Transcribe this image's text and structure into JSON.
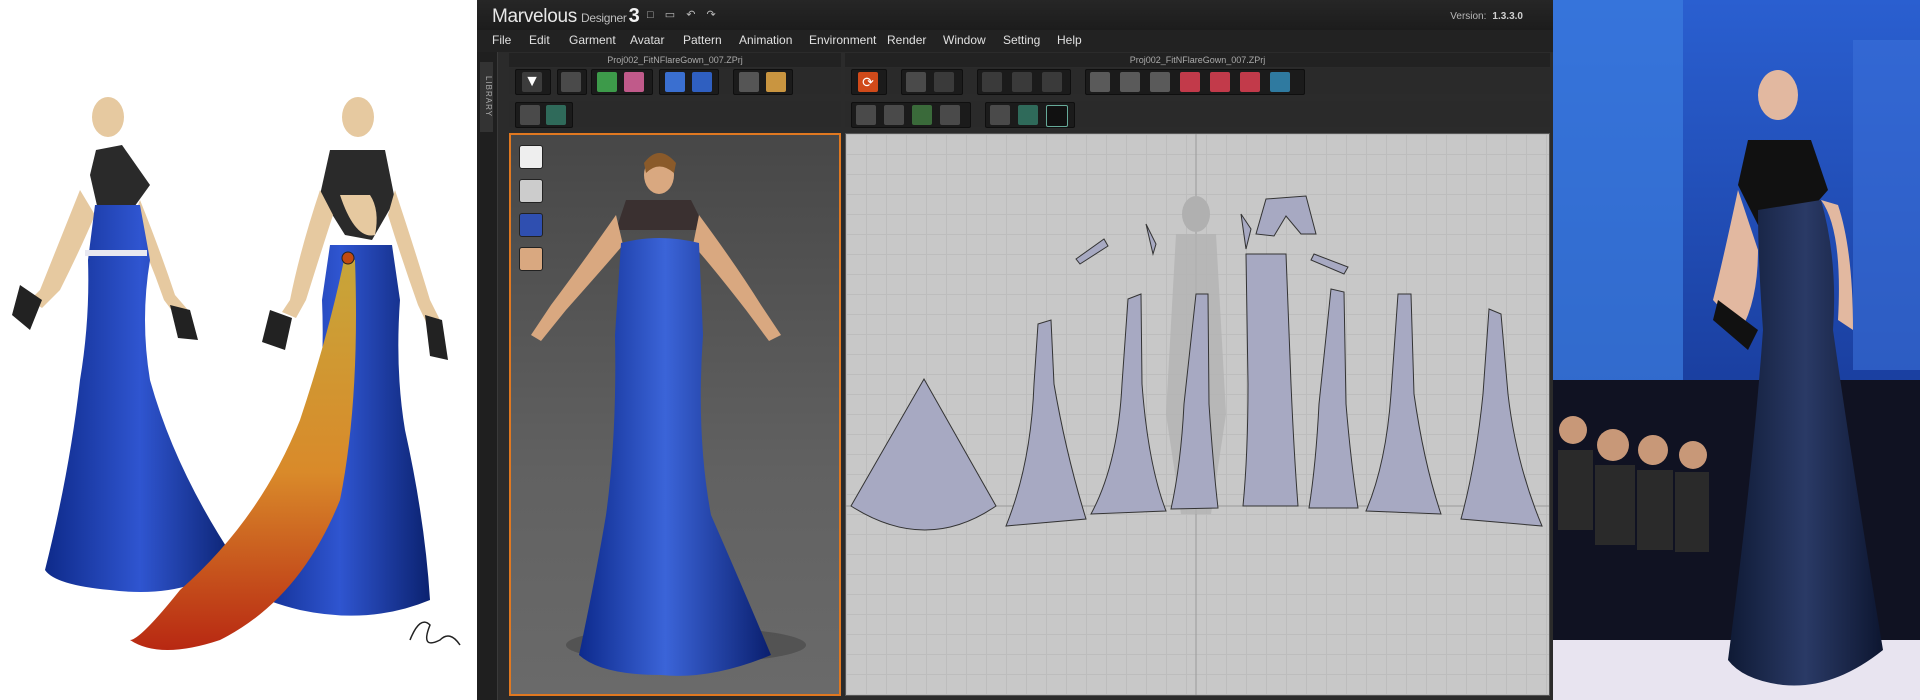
{
  "app": {
    "brand": "Marvelous",
    "brand_sub": "Designer",
    "brand_num": "3",
    "version_label": "Version:",
    "version_value": "1.3.3.0"
  },
  "menu": [
    "File",
    "Edit",
    "Garment",
    "Avatar",
    "Pattern",
    "Animation",
    "Environment",
    "Render",
    "Window",
    "Setting",
    "Help"
  ],
  "sidebar": {
    "library_label": "LIBRARY"
  },
  "panels": {
    "left_title": "Proj002_FitNFlareGown_007.ZPrj",
    "right_title": "Proj002_FitNFlareGown_007.ZPrj"
  },
  "icons": {
    "topbar": [
      "save-icon",
      "open-folder-icon",
      "undo-icon",
      "redo-icon"
    ],
    "view3d_side": [
      "garment-shirt-icon",
      "avatar-icon",
      "texture-icon",
      "head-icon"
    ]
  },
  "colors": {
    "accent_orange": "#e07820",
    "gown_blue": "#1f3fb0",
    "pattern_fill": "#a7a9c2",
    "dark_gown": "#1b2540"
  }
}
